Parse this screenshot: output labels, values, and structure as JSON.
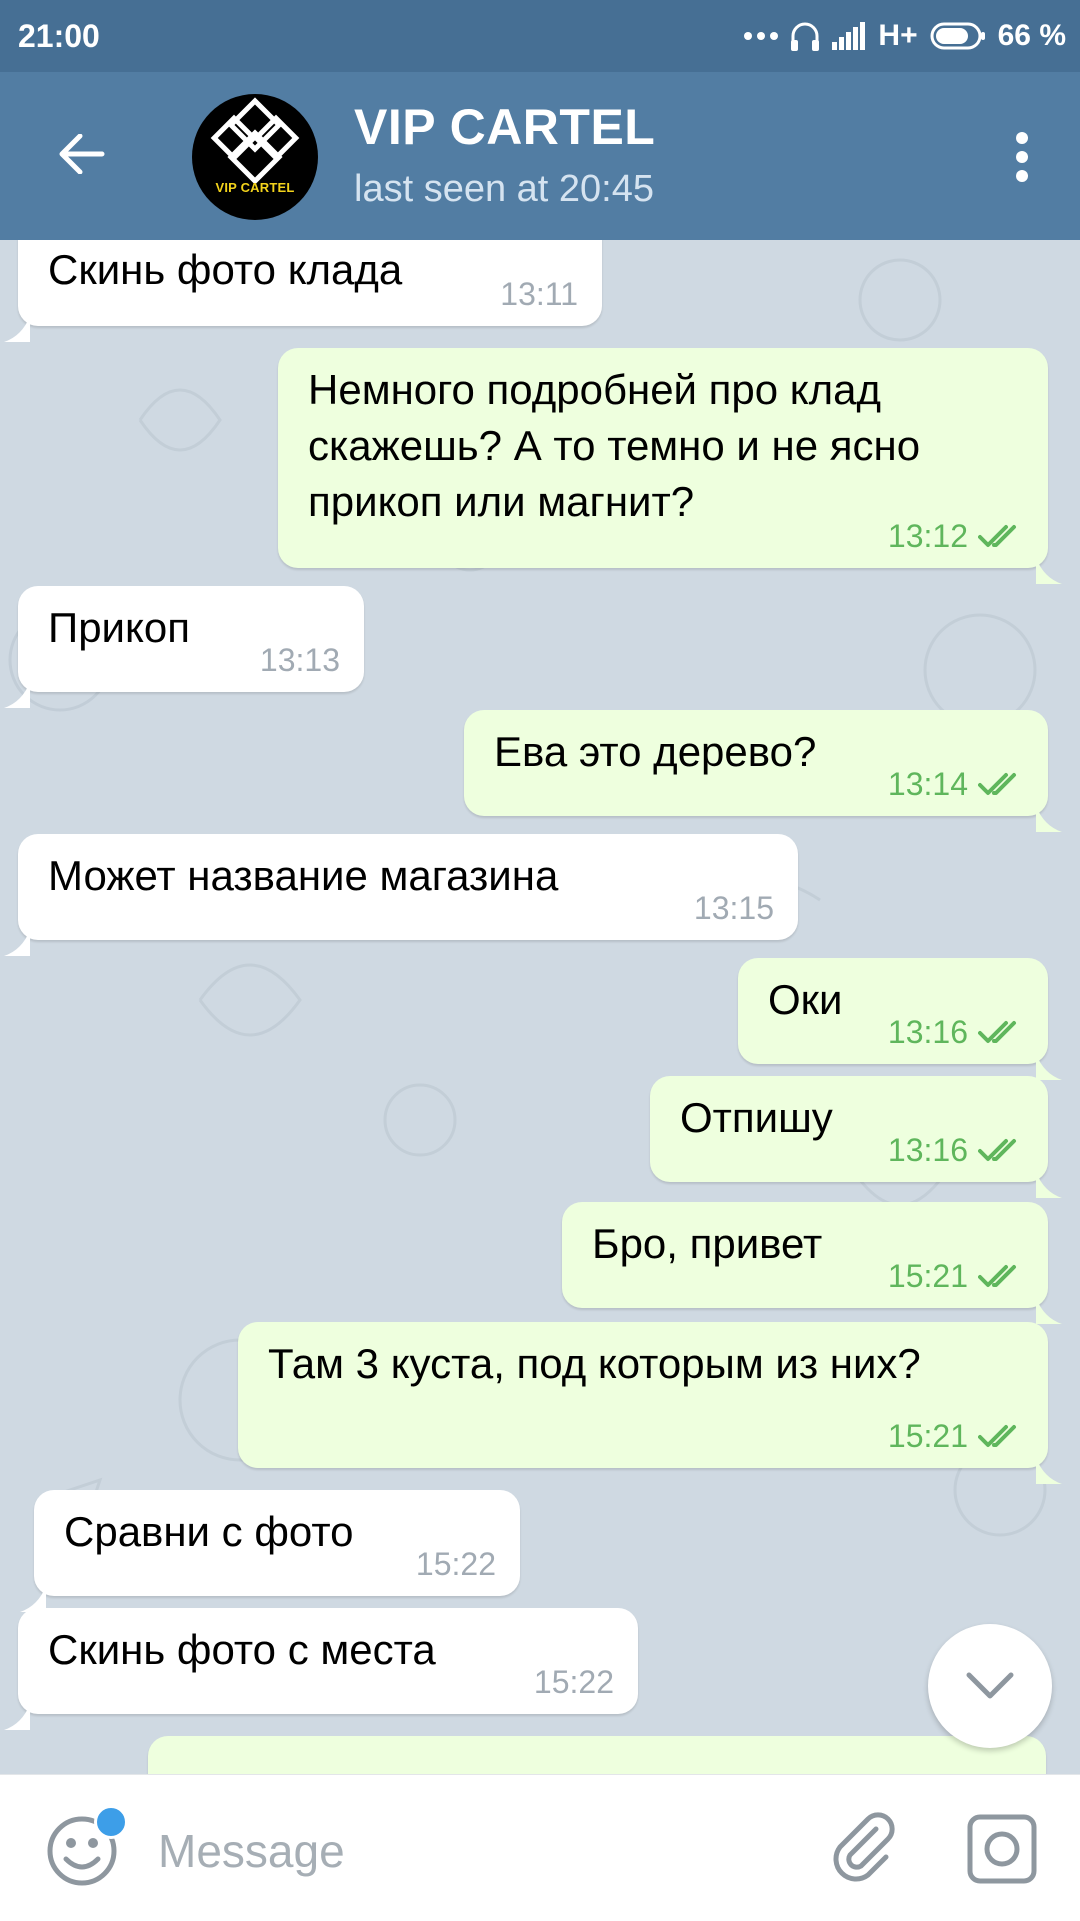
{
  "status_bar": {
    "time": "21:00",
    "battery": "66 %",
    "network": "H+"
  },
  "header": {
    "title": "VIP CARTEL",
    "subtitle": "last seen at 20:45",
    "avatar_text": "VIP CARTEL"
  },
  "messages": [
    {
      "dir": "in",
      "text": "Скинь фото клада",
      "time": "13:11"
    },
    {
      "dir": "out",
      "text": "Немного подробней про клад\nскажешь? А то темно и не ясно\nприкоп или магнит?",
      "time": "13:12"
    },
    {
      "dir": "in",
      "text": "Прикоп",
      "time": "13:13"
    },
    {
      "dir": "out",
      "text": "Ева это дерево?",
      "time": "13:14"
    },
    {
      "dir": "in",
      "text": "Может название магазина",
      "time": "13:15"
    },
    {
      "dir": "out",
      "text": "Оки",
      "time": "13:16"
    },
    {
      "dir": "out",
      "text": "Отпишу",
      "time": "13:16"
    },
    {
      "dir": "out",
      "text": "Бро, привет",
      "time": "15:21"
    },
    {
      "dir": "out",
      "text": "Там 3 куста, под которым из них?",
      "time": "15:21"
    },
    {
      "dir": "in",
      "text": "Сравни с фото",
      "time": "15:22"
    },
    {
      "dir": "in",
      "text": "Скинь фото с места",
      "time": "15:22"
    }
  ],
  "input": {
    "placeholder": "Message"
  },
  "colors": {
    "header": "#527da3",
    "status_bar": "#466f94",
    "outgoing_bubble": "#eeffde",
    "incoming_bubble": "#ffffff",
    "read_check": "#5fb65c"
  },
  "icons": [
    "back-arrow-icon",
    "more-vert-icon",
    "emoji-icon",
    "attach-icon",
    "camera-icon",
    "chevron-down-icon",
    "double-check-icon"
  ]
}
